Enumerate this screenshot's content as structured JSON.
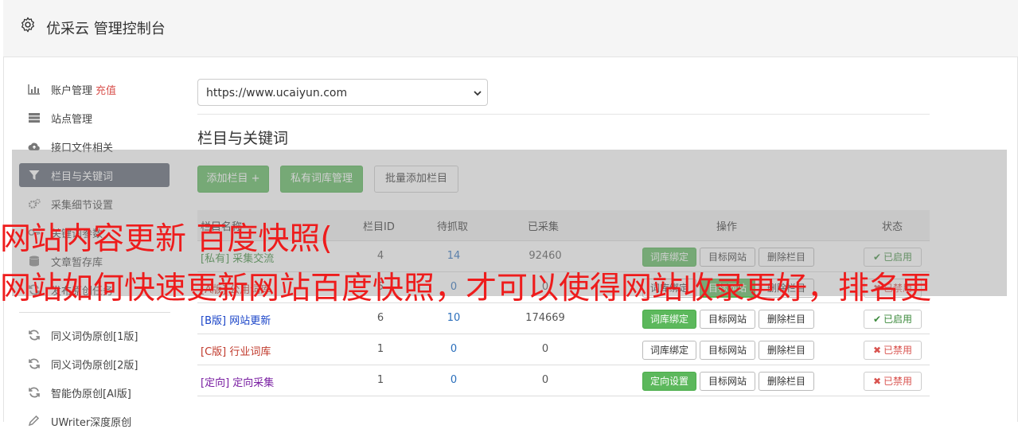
{
  "header": {
    "title": "优采云 管理控制台"
  },
  "sidebar": {
    "items": [
      {
        "label": "账户管理",
        "extra": "充值",
        "icon": "bar-chart-icon"
      },
      {
        "label": "站点管理",
        "icon": "server-icon"
      },
      {
        "label": "接口文件相关",
        "icon": "cloud-upload-icon"
      },
      {
        "label": "栏目与关键词",
        "icon": "filter-icon"
      },
      {
        "label": "采集细节设置",
        "icon": "cogs-icon"
      },
      {
        "label": "关键词参数",
        "icon": "key-icon"
      },
      {
        "label": "文章暂存库",
        "icon": "database-icon"
      },
      {
        "label": "发布原创任务",
        "icon": "refresh-icon"
      },
      {
        "label": "同义词伪原创[1版]",
        "icon": "refresh-icon"
      },
      {
        "label": "同义词伪原创[2版]",
        "icon": "refresh-icon"
      },
      {
        "label": "智能伪原创[AI版]",
        "icon": "refresh-icon"
      },
      {
        "label": "UWriter深度原创",
        "icon": "pencil-icon"
      }
    ]
  },
  "main": {
    "site_select": {
      "value": "https://www.ucaiyun.com"
    },
    "section_title": "栏目与关键词",
    "buttons": {
      "add_column": "添加栏目 +",
      "private_lib": "私有词库管理",
      "batch_add": "批量添加栏目"
    },
    "table": {
      "headers": [
        "栏目名称",
        "栏目ID",
        "待抓取",
        "已采集",
        "操作",
        "状态"
      ],
      "rows": [
        {
          "tag": "[私有]",
          "name": "采集交流",
          "id": "4",
          "pending": "14",
          "collected": "92460",
          "bind_label": "词库绑定",
          "target_label": "目标网站",
          "delete_label": "删除栏目",
          "status": "已启用"
        },
        {
          "tag": "[A版]",
          "name": "公用词库",
          "id": "5",
          "pending": "0",
          "collected": "0",
          "bind_label": "词库绑定",
          "target_label": "目标网站",
          "delete_label": "删除栏目",
          "status": "已禁用"
        },
        {
          "tag": "[B版]",
          "name": "网站更新",
          "id": "6",
          "pending": "10",
          "collected": "174669",
          "bind_label": "词库绑定",
          "target_label": "目标网站",
          "delete_label": "删除栏目",
          "status": "已启用"
        },
        {
          "tag": "[C版]",
          "name": "行业词库",
          "id": "1",
          "pending": "0",
          "collected": "0",
          "bind_label": "词库绑定",
          "target_label": "目标网站",
          "delete_label": "删除栏目",
          "status": "已禁用"
        },
        {
          "tag": "[定向]",
          "name": "定向采集",
          "id": "1",
          "pending": "0",
          "collected": "0",
          "bind_label": "定向设置",
          "target_label": "目标网站",
          "delete_label": "删除栏目",
          "status": "已禁用"
        }
      ]
    }
  },
  "watermark": {
    "line1": "网站内容更新 百度快照(",
    "line2": "网站如何快速更新网站百度快照，才可以使得网站收录更好，排名更"
  },
  "colors": {
    "green": "#5cb85c",
    "active_sidebar": "#5a6270",
    "watermark": "#ee1c1c",
    "tag_private": "#3c8a3c",
    "tag_a": "#c0392b",
    "tag_b": "#1a44c8",
    "tag_c": "#c0392b",
    "tag_directed": "#7a1fa2"
  }
}
